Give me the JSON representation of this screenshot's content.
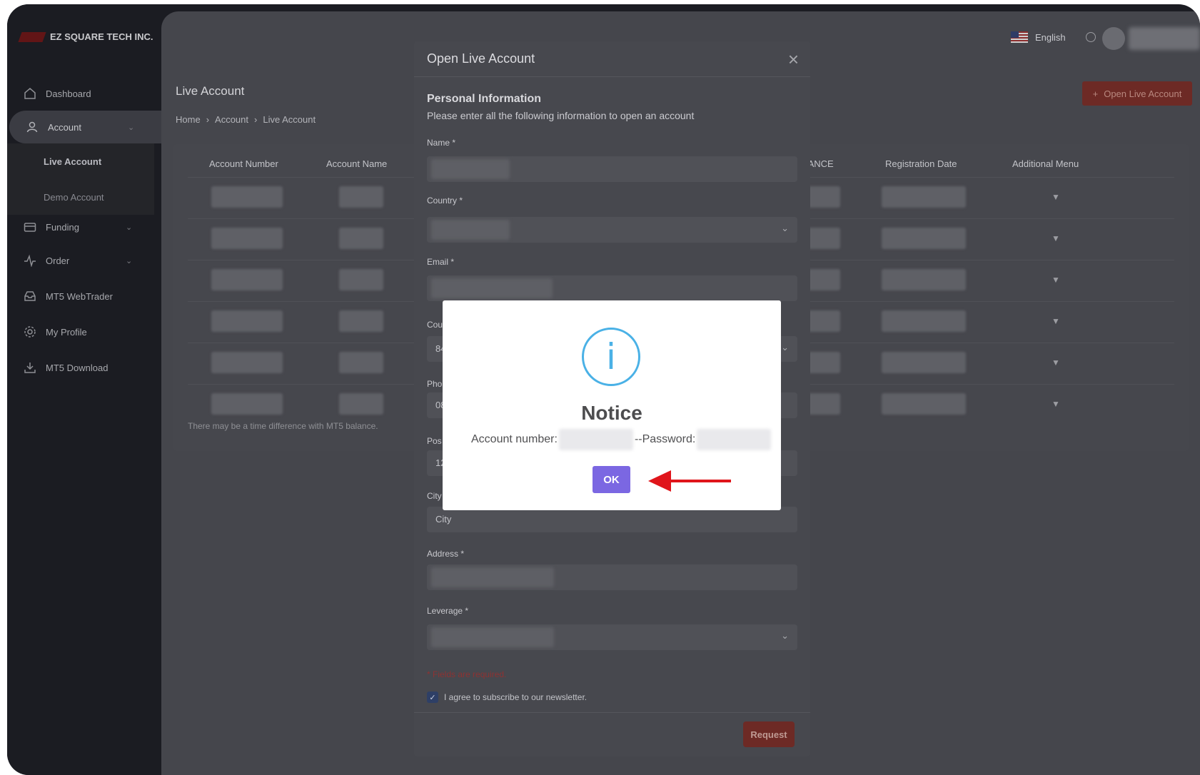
{
  "brand": {
    "name": "EZ SQUARE TECH INC."
  },
  "sidebar": {
    "items": [
      {
        "label": "Dashboard",
        "icon": "home-icon"
      },
      {
        "label": "Account",
        "icon": "user-icon"
      },
      {
        "label": "Funding",
        "icon": "card-icon"
      },
      {
        "label": "Order",
        "icon": "pulse-icon"
      },
      {
        "label": "MT5 WebTrader",
        "icon": "tray-icon"
      },
      {
        "label": "My Profile",
        "icon": "gear-icon"
      },
      {
        "label": "MT5 Download",
        "icon": "download-icon"
      }
    ],
    "sub_items": [
      {
        "label": "Live Account"
      },
      {
        "label": "Demo Account"
      }
    ]
  },
  "header": {
    "language": "English",
    "open_account_button": "Open Live Account"
  },
  "page": {
    "title": "Live Account",
    "breadcrumb": [
      "Home",
      "Account",
      "Live Account"
    ],
    "breadcrumb_sep": "›"
  },
  "table": {
    "columns": [
      "Account Number",
      "Account Name",
      "BALANCE",
      "Registration Date",
      "Additional Menu"
    ],
    "note": "There may be a time difference with MT5 balance.",
    "row_menu_glyph": "▼"
  },
  "modal": {
    "title": "Open Live Account",
    "section_title": "Personal Information",
    "section_subtitle": "Please enter all the following information to open an account",
    "labels": {
      "name": "Name *",
      "country": "Country *",
      "email": "Email *",
      "address": "Address *",
      "leverage": "Leverage *",
      "city": "City",
      "country_code_partial": "Cou",
      "phone_partial": "Pho",
      "postal_partial": "Pos"
    },
    "values": {
      "city": "City",
      "country_code_partial": "84",
      "phone_partial": "08",
      "postal_partial": "12"
    },
    "required_note": "* Fields are required.",
    "newsletter_label": "I agree to subscribe to our newsletter.",
    "newsletter_checked": true,
    "request_button": "Request",
    "close_glyph": "×"
  },
  "notice": {
    "icon_glyph": "i",
    "title": "Notice",
    "account_label": "Account number:",
    "separator": "-- ",
    "password_label": "Password:",
    "ok_button": "OK"
  },
  "colors": {
    "accent": "#7b67e2",
    "info": "#4ab1e6",
    "danger": "#d9321f",
    "arrow": "#e0151b"
  }
}
